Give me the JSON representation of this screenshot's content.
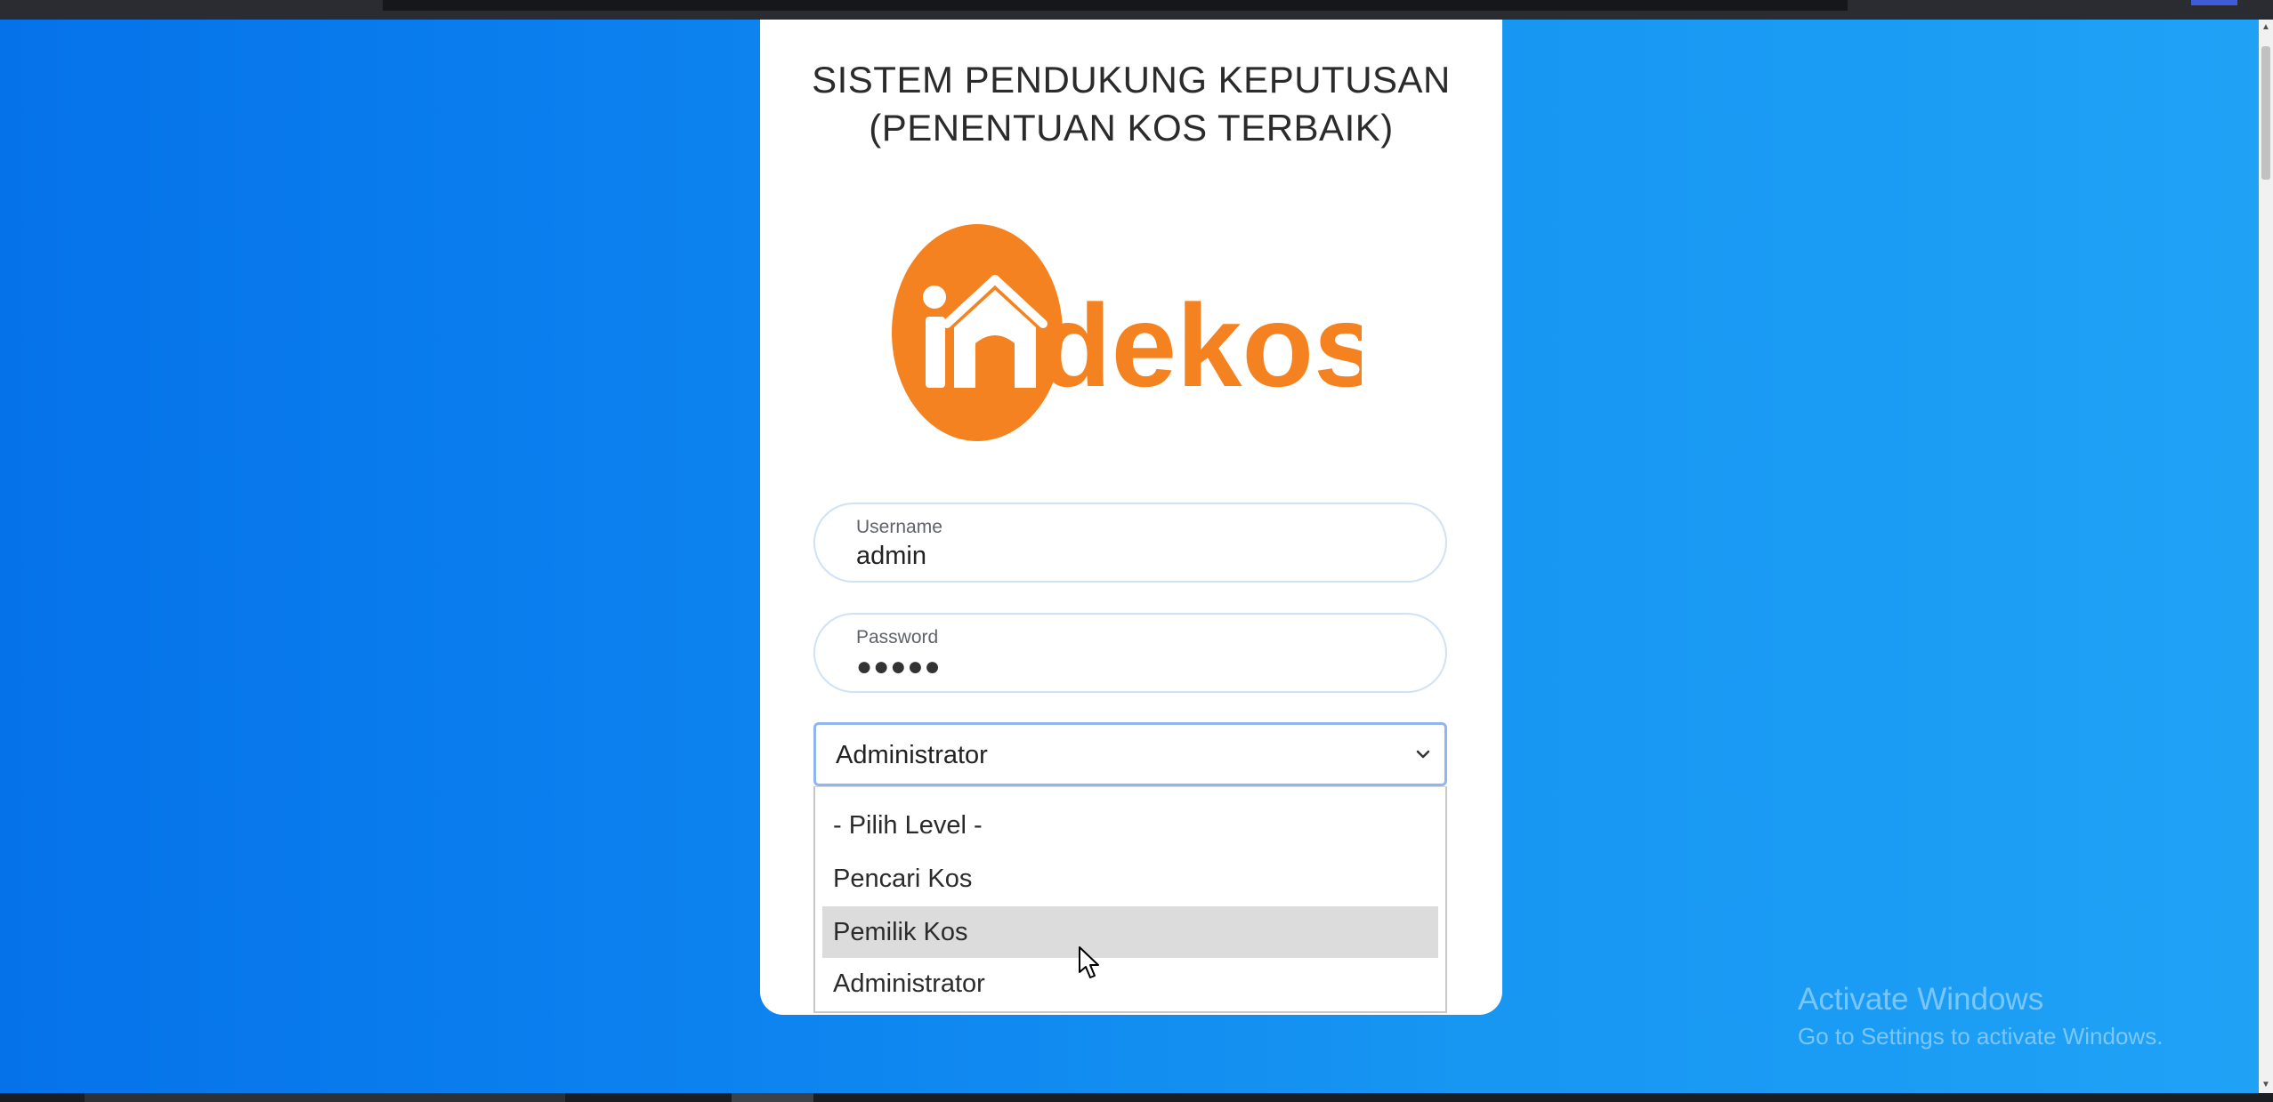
{
  "header": {
    "title_line1": "SISTEM PENDUKUNG KEPUTUSAN",
    "title_line2": "(PENENTUAN KOS TERBAIK)"
  },
  "logo": {
    "text_in": "in",
    "text_rest": "dekos",
    "brand_color": "#f58220"
  },
  "form": {
    "username": {
      "label": "Username",
      "value": "admin"
    },
    "password": {
      "label": "Password",
      "value_masked": "●●●●●"
    },
    "level_select": {
      "selected": "Administrator",
      "options": [
        "- Pilih Level -",
        "Pencari Kos",
        "Pemilik Kos",
        "Administrator"
      ],
      "highlighted": "Pemilik Kos"
    }
  },
  "watermark": {
    "line1": "Activate Windows",
    "line2": "Go to Settings to activate Windows."
  },
  "colors": {
    "background_gradient_start": "#0572ea",
    "background_gradient_end": "#1fa2f6",
    "highlight_option": "#dcdcdc"
  }
}
